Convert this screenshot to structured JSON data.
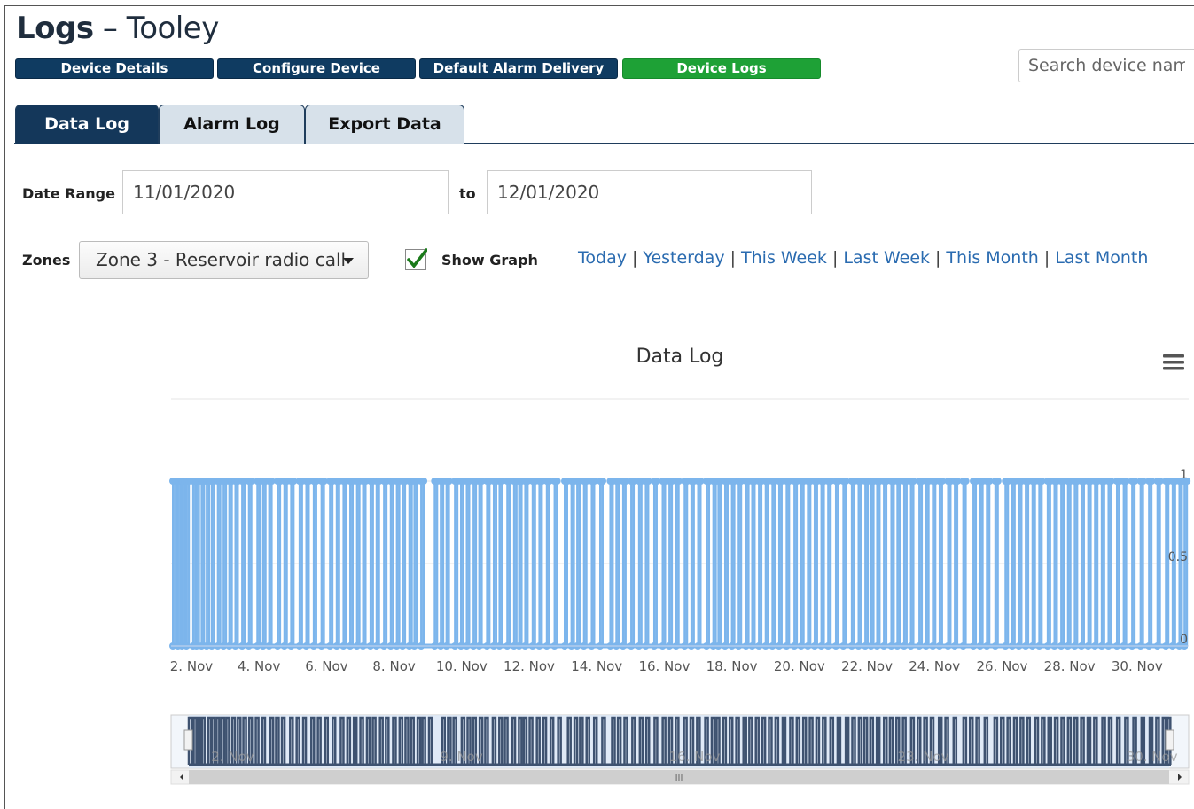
{
  "header": {
    "title_bold": "Logs",
    "title_sep": " – ",
    "title_device": "Tooley"
  },
  "nav": [
    {
      "label": "Device Details",
      "active": false
    },
    {
      "label": "Configure Device",
      "active": false
    },
    {
      "label": "Default Alarm Delivery",
      "active": false
    },
    {
      "label": "Device Logs",
      "active": true
    }
  ],
  "search": {
    "placeholder": "Search device name"
  },
  "tabs": [
    {
      "label": "Data Log",
      "active": true
    },
    {
      "label": "Alarm Log",
      "active": false
    },
    {
      "label": "Export Data",
      "active": false
    }
  ],
  "filters": {
    "date_range_label": "Date Range",
    "start_date": "11/01/2020",
    "to_label": "to",
    "end_date": "12/01/2020",
    "zones_label": "Zones",
    "zone_selected": "Zone 3 - Reservoir radio call",
    "show_graph_label": "Show Graph",
    "show_graph_checked": true,
    "quick_ranges": [
      "Today",
      "Yesterday",
      "This Week",
      "Last Week",
      "This Month",
      "Last Month"
    ]
  },
  "colors": {
    "navy": "#0f3b61",
    "green": "#1ea136",
    "series": "#7cb5ec",
    "navigator_series": "#3e5270"
  },
  "chart_data": {
    "type": "area",
    "title": "Data Log",
    "menu_icon": "hamburger-icon",
    "x_unit": "day of November 2020",
    "xlim": [
      1.45,
      31.5
    ],
    "ylim": [
      0,
      1
    ],
    "y_ticks": [
      "0",
      "0.5",
      "1"
    ],
    "x_ticks": [
      "2. Nov",
      "4. Nov",
      "6. Nov",
      "8. Nov",
      "10. Nov",
      "12. Nov",
      "14. Nov",
      "16. Nov",
      "18. Nov",
      "20. Nov",
      "22. Nov",
      "24. Nov",
      "26. Nov",
      "28. Nov",
      "30. Nov"
    ],
    "x_tick_days": [
      2,
      4,
      6,
      8,
      10,
      12,
      14,
      16,
      18,
      20,
      22,
      24,
      26,
      28,
      30
    ],
    "description": "Binary signal alternating between 0 and 1, pulses roughly every few hours across the month",
    "pulses": [
      [
        1.45,
        1.55
      ],
      [
        1.6,
        1.66
      ],
      [
        1.72,
        1.78
      ],
      [
        1.85,
        1.9
      ],
      [
        2.05,
        2.1
      ],
      [
        2.15,
        2.22
      ],
      [
        2.3,
        2.35
      ],
      [
        2.45,
        2.52
      ],
      [
        2.6,
        2.66
      ],
      [
        2.78,
        2.85
      ],
      [
        2.95,
        3.0
      ],
      [
        3.12,
        3.2
      ],
      [
        3.3,
        3.37
      ],
      [
        3.5,
        3.55
      ],
      [
        3.7,
        3.75
      ],
      [
        3.95,
        4.02
      ],
      [
        4.12,
        4.18
      ],
      [
        4.3,
        4.36
      ],
      [
        4.55,
        4.6
      ],
      [
        4.75,
        4.82
      ],
      [
        4.95,
        5.0
      ],
      [
        5.2,
        5.25
      ],
      [
        5.4,
        5.46
      ],
      [
        5.62,
        5.7
      ],
      [
        5.85,
        5.92
      ],
      [
        6.1,
        6.16
      ],
      [
        6.3,
        6.37
      ],
      [
        6.5,
        6.56
      ],
      [
        6.7,
        6.76
      ],
      [
        6.9,
        6.96
      ],
      [
        7.08,
        7.14
      ],
      [
        7.3,
        7.36
      ],
      [
        7.48,
        7.55
      ],
      [
        7.7,
        7.75
      ],
      [
        7.9,
        7.96
      ],
      [
        8.08,
        8.15
      ],
      [
        8.25,
        8.32
      ],
      [
        8.45,
        8.5
      ],
      [
        8.6,
        8.67
      ],
      [
        8.8,
        8.86
      ],
      [
        9.2,
        9.26
      ],
      [
        9.38,
        9.44
      ],
      [
        9.55,
        9.6
      ],
      [
        9.8,
        9.86
      ],
      [
        9.98,
        10.04
      ],
      [
        10.15,
        10.22
      ],
      [
        10.35,
        10.4
      ],
      [
        10.52,
        10.58
      ],
      [
        10.75,
        10.8
      ],
      [
        10.95,
        11.0
      ],
      [
        11.12,
        11.2
      ],
      [
        11.35,
        11.4
      ],
      [
        11.55,
        11.6
      ],
      [
        11.7,
        11.76
      ],
      [
        11.88,
        11.95
      ],
      [
        12.1,
        12.16
      ],
      [
        12.3,
        12.36
      ],
      [
        12.52,
        12.58
      ],
      [
        12.75,
        12.8
      ],
      [
        13.05,
        13.12
      ],
      [
        13.25,
        13.3
      ],
      [
        13.42,
        13.48
      ],
      [
        13.62,
        13.68
      ],
      [
        13.85,
        13.92
      ],
      [
        14.1,
        14.16
      ],
      [
        14.4,
        14.46
      ],
      [
        14.58,
        14.64
      ],
      [
        14.78,
        14.84
      ],
      [
        15.02,
        15.08
      ],
      [
        15.25,
        15.3
      ],
      [
        15.45,
        15.52
      ],
      [
        15.7,
        15.76
      ],
      [
        15.95,
        16.0
      ],
      [
        16.15,
        16.2
      ],
      [
        16.35,
        16.42
      ],
      [
        16.6,
        16.66
      ],
      [
        16.8,
        16.86
      ],
      [
        17.0,
        17.06
      ],
      [
        17.25,
        17.32
      ],
      [
        17.45,
        17.5
      ],
      [
        17.6,
        17.66
      ],
      [
        17.8,
        17.86
      ],
      [
        18.0,
        18.06
      ],
      [
        18.2,
        18.26
      ],
      [
        18.42,
        18.48
      ],
      [
        18.6,
        18.66
      ],
      [
        18.8,
        18.86
      ],
      [
        19.0,
        19.06
      ],
      [
        19.2,
        19.26
      ],
      [
        19.4,
        19.46
      ],
      [
        19.62,
        19.68
      ],
      [
        19.85,
        19.9
      ],
      [
        20.05,
        20.1
      ],
      [
        20.25,
        20.3
      ],
      [
        20.45,
        20.52
      ],
      [
        20.65,
        20.7
      ],
      [
        20.85,
        20.92
      ],
      [
        21.08,
        21.14
      ],
      [
        21.3,
        21.36
      ],
      [
        21.55,
        21.6
      ],
      [
        21.75,
        21.8
      ],
      [
        21.95,
        22.0
      ],
      [
        22.12,
        22.18
      ],
      [
        22.3,
        22.36
      ],
      [
        22.5,
        22.56
      ],
      [
        22.72,
        22.78
      ],
      [
        22.9,
        22.96
      ],
      [
        23.1,
        23.16
      ],
      [
        23.3,
        23.36
      ],
      [
        23.55,
        23.6
      ],
      [
        23.75,
        23.8
      ],
      [
        23.95,
        24.0
      ],
      [
        24.15,
        24.2
      ],
      [
        24.4,
        24.46
      ],
      [
        24.6,
        24.66
      ],
      [
        24.85,
        24.9
      ],
      [
        25.15,
        25.2
      ],
      [
        25.35,
        25.4
      ],
      [
        25.55,
        25.6
      ],
      [
        25.8,
        25.85
      ],
      [
        26.1,
        26.16
      ],
      [
        26.3,
        26.36
      ],
      [
        26.5,
        26.56
      ],
      [
        26.7,
        26.76
      ],
      [
        26.9,
        26.96
      ],
      [
        27.1,
        27.16
      ],
      [
        27.35,
        27.4
      ],
      [
        27.55,
        27.6
      ],
      [
        27.75,
        27.8
      ],
      [
        27.95,
        28.0
      ],
      [
        28.15,
        28.2
      ],
      [
        28.35,
        28.4
      ],
      [
        28.55,
        28.6
      ],
      [
        28.75,
        28.8
      ],
      [
        28.95,
        29.0
      ],
      [
        29.15,
        29.2
      ],
      [
        29.4,
        29.46
      ],
      [
        29.6,
        29.66
      ],
      [
        29.85,
        29.9
      ],
      [
        30.1,
        30.16
      ],
      [
        30.35,
        30.4
      ],
      [
        30.6,
        30.66
      ],
      [
        30.85,
        30.9
      ],
      [
        31.05,
        31.1
      ],
      [
        31.25,
        31.3
      ],
      [
        31.4,
        31.46
      ]
    ],
    "navigator": {
      "x_ticks": [
        "2. Nov",
        "9. Nov",
        "16. Nov",
        "23. Nov",
        "30. Nov"
      ],
      "x_tick_days": [
        2,
        9,
        16,
        23,
        30
      ],
      "scrollbar_grip": "III"
    }
  }
}
